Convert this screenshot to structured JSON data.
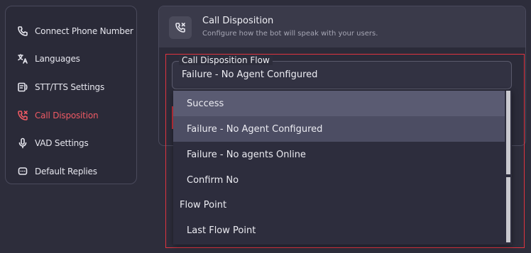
{
  "sidebar": {
    "items": [
      {
        "label": "Connect Phone Number",
        "icon": "phone-icon"
      },
      {
        "label": "Languages",
        "icon": "translate-icon"
      },
      {
        "label": "STT/TTS Settings",
        "icon": "speech-text-icon"
      },
      {
        "label": "Call Disposition",
        "icon": "phone-x-icon",
        "active": true
      },
      {
        "label": "VAD Settings",
        "icon": "microphone-icon"
      },
      {
        "label": "Default Replies",
        "icon": "chat-icon"
      }
    ]
  },
  "panel": {
    "title": "Call Disposition",
    "subtitle": "Configure how the bot will speak with your users.",
    "icon": "phone-x-icon"
  },
  "form": {
    "field_label": "Call Disposition Flow",
    "selected_value": "Failure - No Agent Configured",
    "options": [
      "Success",
      "Failure - No Agent Configured",
      "Failure - No agents Online",
      "Confirm No",
      "Flow Point",
      "Last Flow Point"
    ]
  },
  "colors": {
    "accent": "#ef5a64",
    "background": "#2d2d3b",
    "highlight_hover": "#5a5b72",
    "highlight_selected": "#4c4d63"
  }
}
